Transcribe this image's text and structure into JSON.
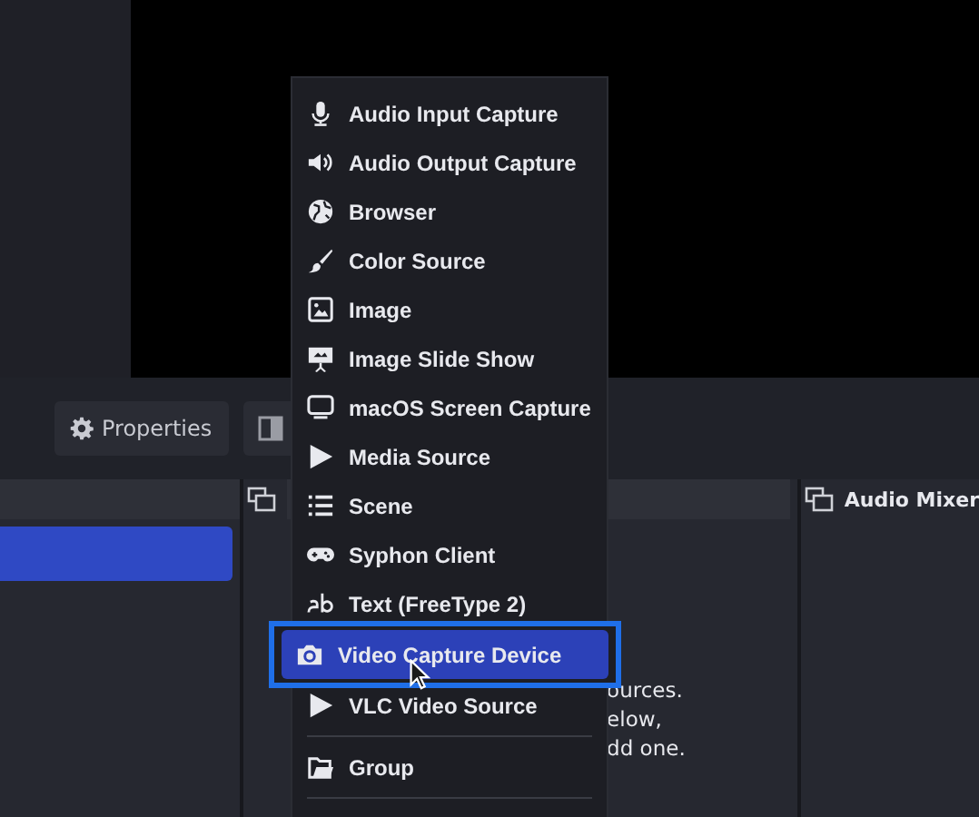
{
  "toolbar": {
    "properties_button": "Properties"
  },
  "sources_dock": {
    "hint_lines": [
      "ources.",
      "elow,",
      "dd one."
    ]
  },
  "audio_mixer": {
    "title": "Audio Mixer"
  },
  "add_source_menu": {
    "items": [
      {
        "label": "Audio Input Capture",
        "selected": false
      },
      {
        "label": "Audio Output Capture",
        "selected": false
      },
      {
        "label": "Browser",
        "selected": false
      },
      {
        "label": "Color Source",
        "selected": false
      },
      {
        "label": "Image",
        "selected": false
      },
      {
        "label": "Image Slide Show",
        "selected": false
      },
      {
        "label": "macOS Screen Capture",
        "selected": false
      },
      {
        "label": "Media Source",
        "selected": false
      },
      {
        "label": "Scene",
        "selected": false
      },
      {
        "label": "Syphon Client",
        "selected": false
      },
      {
        "label": "Text (FreeType 2)",
        "selected": false
      },
      {
        "label": "Video Capture Device",
        "selected": true
      },
      {
        "label": "VLC Video Source",
        "selected": false,
        "separator_after": true
      },
      {
        "label": "Group",
        "selected": false,
        "separator_after": true
      }
    ]
  }
}
